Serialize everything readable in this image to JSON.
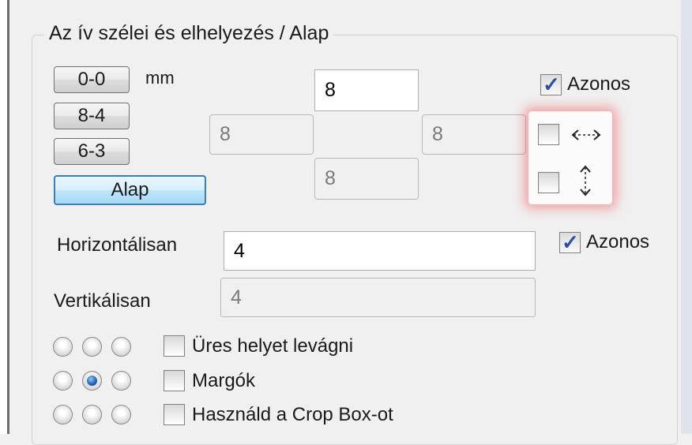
{
  "group": {
    "title": "Az ív szélei és elhelyezés / Alap"
  },
  "presets": {
    "b00": "0-0",
    "b84": "8-4",
    "b63": "6-3",
    "alap": "Alap",
    "unit": "mm"
  },
  "margins": {
    "top": "8",
    "left": "8",
    "right": "8",
    "bottom": "8"
  },
  "azonos_margin": {
    "label": "Azonos",
    "checked": true
  },
  "mirror": {
    "horizontal_checked": false,
    "vertical_checked": false
  },
  "spacing": {
    "horizontal_label": "Horizontálisan",
    "horizontal_value": "4",
    "vertical_label": "Vertikálisan",
    "vertical_value": "4",
    "azonos_label": "Azonos",
    "azonos_checked": true
  },
  "options": {
    "ures": "Üres helyet levágni",
    "margok": "Margók",
    "crop": "Használd a Crop Box-ot"
  },
  "alignment": {
    "selected_row": 2,
    "selected_col": 2
  }
}
